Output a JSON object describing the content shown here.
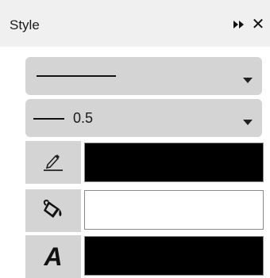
{
  "panel": {
    "title": "Style",
    "close_glyph": "✕"
  },
  "line_style": {
    "selected": "solid"
  },
  "line_width": {
    "value": "0.5"
  },
  "colors": {
    "stroke": "#000000",
    "fill": "#ffffff",
    "text": "#000000"
  },
  "icons": {
    "more": "double-chevron-right-icon",
    "close": "close-icon",
    "stroke": "pencil-underline-icon",
    "fill": "paint-bucket-icon",
    "text": "text-a-icon",
    "caret": "caret-down-icon"
  },
  "text_icon_glyph": "A"
}
